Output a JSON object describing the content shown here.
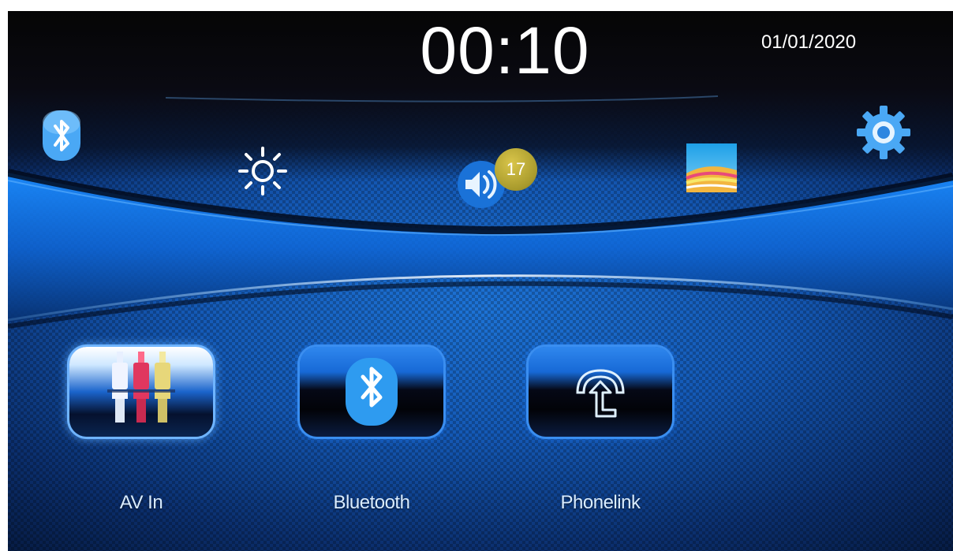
{
  "status_bar": {
    "time": "00:10",
    "date": "01/01/2020"
  },
  "quick_controls": {
    "volume_level": "17",
    "icons": [
      "bluetooth-icon",
      "brightness-icon",
      "volume-icon",
      "wallpaper-icon",
      "settings-icon"
    ]
  },
  "apps": [
    {
      "label": "AV In",
      "icon": "av-in-icon",
      "selected": true
    },
    {
      "label": "Bluetooth",
      "icon": "bluetooth-icon",
      "selected": false
    },
    {
      "label": "Phonelink",
      "icon": "phonelink-icon",
      "selected": false
    }
  ],
  "colors": {
    "accent": "#2f87ee",
    "badge": "#c2b23c",
    "label": "#d9ecff"
  }
}
